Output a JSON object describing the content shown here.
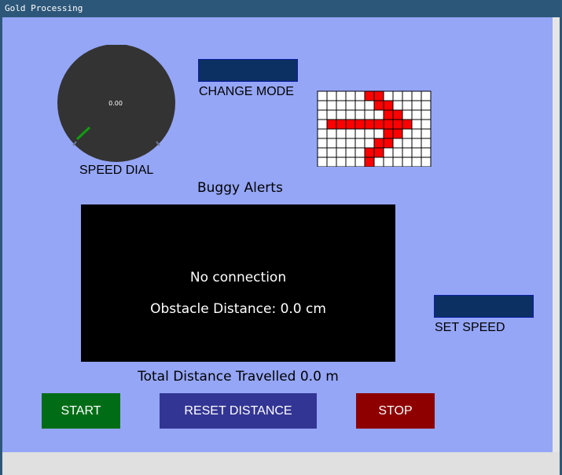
{
  "window": {
    "title": "Gold Processing"
  },
  "speed_dial": {
    "value": "0.00",
    "label": "SPEED DIAL"
  },
  "mode": {
    "label": "CHANGE MODE"
  },
  "direction_grid": {
    "cols": 12,
    "rows": 8,
    "filled_color": "#ff0000",
    "empty_color": "#ffffff",
    "filled": [
      [
        0,
        5
      ],
      [
        0,
        6
      ],
      [
        1,
        6
      ],
      [
        1,
        7
      ],
      [
        2,
        7
      ],
      [
        2,
        8
      ],
      [
        3,
        1
      ],
      [
        3,
        2
      ],
      [
        3,
        3
      ],
      [
        3,
        4
      ],
      [
        3,
        5
      ],
      [
        3,
        6
      ],
      [
        3,
        7
      ],
      [
        3,
        8
      ],
      [
        3,
        9
      ],
      [
        4,
        7
      ],
      [
        4,
        8
      ],
      [
        5,
        6
      ],
      [
        5,
        7
      ],
      [
        6,
        5
      ],
      [
        6,
        6
      ],
      [
        7,
        5
      ]
    ]
  },
  "alerts": {
    "heading": "Buggy Alerts",
    "status": "No connection",
    "obstacle": "Obstacle Distance: 0.0 cm"
  },
  "speed": {
    "label": "SET SPEED"
  },
  "distance": {
    "text": "Total Distance Travelled 0.0 m"
  },
  "buttons": {
    "start": {
      "label": "START",
      "color": "#006d16"
    },
    "reset": {
      "label": "RESET DISTANCE",
      "color": "#333594"
    },
    "stop": {
      "label": "STOP",
      "color": "#8e0000"
    }
  }
}
